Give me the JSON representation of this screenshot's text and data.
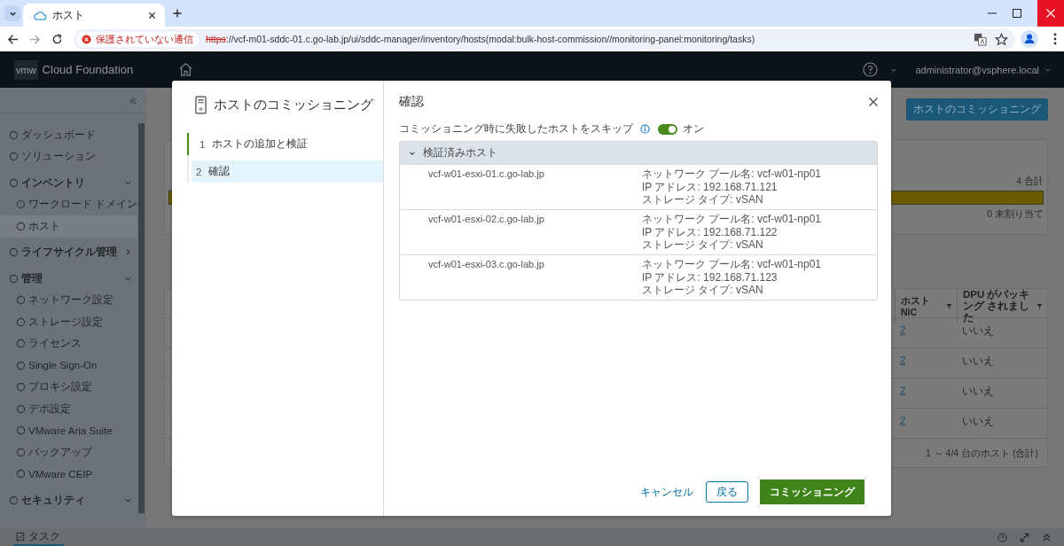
{
  "browser": {
    "tabs": [
      {
        "title": "ホスト",
        "selected": true
      }
    ],
    "security_label": "保護されていない通信",
    "url_scheme": "https",
    "url_rest": "://vcf-m01-sddc-01.c.go-lab.jp/ui/sddc-manager/inventory/hosts(modal:bulk-host-commission//monitoring-panel:monitoring/tasks)"
  },
  "app": {
    "logo": "vmw",
    "product": "Cloud Foundation",
    "user": "administrator@vsphere.local"
  },
  "sidebar": {
    "collapse": "«",
    "items": [
      {
        "kind": "link",
        "label": "ダッシュボード",
        "selected": false
      },
      {
        "kind": "link",
        "label": "ソリューション",
        "selected": false
      },
      {
        "kind": "group",
        "label": "インベントリ",
        "selected": false,
        "expanded": true,
        "children": [
          {
            "label": "ワークロード ドメイン",
            "selected": false
          },
          {
            "label": "ホスト",
            "selected": true
          }
        ]
      },
      {
        "kind": "group",
        "label": "ライフサイクル管理",
        "selected": false,
        "expanded": false
      },
      {
        "kind": "group",
        "label": "管理",
        "selected": false,
        "expanded": true,
        "children": [
          {
            "label": "ネットワーク設定",
            "selected": false
          },
          {
            "label": "ストレージ設定",
            "selected": false
          },
          {
            "label": "ライセンス",
            "selected": false
          },
          {
            "label": "Single Sign-On",
            "selected": false
          },
          {
            "label": "プロキシ設定",
            "selected": false
          },
          {
            "label": "デポ設定",
            "selected": false
          },
          {
            "label": "VMware Aria Suite",
            "selected": false
          },
          {
            "label": "バックアップ",
            "selected": false
          },
          {
            "label": "VMware CEIP",
            "selected": false
          }
        ]
      },
      {
        "kind": "group",
        "label": "セキュリティ",
        "selected": false,
        "expanded": true
      }
    ]
  },
  "page": {
    "action_button": "ホストのコミッショニング",
    "summary": {
      "total": "4 合計",
      "level": 1,
      "unassigned": "0 未割り当て"
    },
    "table": {
      "columns": [
        "ホスト NIC",
        "DPU がバッキング されました"
      ],
      "rows": [
        {
          "nic": "2",
          "dpu": "いいえ"
        },
        {
          "nic": "2",
          "dpu": "いいえ"
        },
        {
          "nic": "2",
          "dpu": "いいえ"
        },
        {
          "nic": "2",
          "dpu": "いいえ"
        }
      ],
      "footer": "1 ～ 4/4 台のホスト (合計)"
    }
  },
  "modal": {
    "title": "ホストのコミッショニング",
    "steps": [
      {
        "number": "1",
        "label": "ホストの追加と検証",
        "selected": false,
        "completed": true
      },
      {
        "number": "2",
        "label": "確認",
        "selected": true,
        "completed": false
      }
    ],
    "heading": "確認",
    "skip_option": {
      "label": "コミッショニング時に失敗したホストをスキップ",
      "on": true,
      "state_text": "オン"
    },
    "accordion": {
      "title": "検証済みホスト",
      "expanded": true,
      "hosts": [
        {
          "name": "vcf-w01-esxi-01.c.go-lab.jp",
          "details": [
            "ネットワーク プール名: vcf-w01-np01",
            "IP アドレス: 192.168.71.121",
            "ストレージ タイプ: vSAN"
          ]
        },
        {
          "name": "vcf-w01-esxi-02.c.go-lab.jp",
          "details": [
            "ネットワーク プール名: vcf-w01-np01",
            "IP アドレス: 192.168.71.122",
            "ストレージ タイプ: vSAN"
          ]
        },
        {
          "name": "vcf-w01-esxi-03.c.go-lab.jp",
          "details": [
            "ネットワーク プール名: vcf-w01-np01",
            "IP アドレス: 192.168.71.123",
            "ストレージ タイプ: vSAN"
          ]
        }
      ]
    },
    "buttons": [
      {
        "kind": "link",
        "label": "キャンセル",
        "highlighted": false
      },
      {
        "kind": "outline",
        "label": "戻る",
        "highlighted": false
      },
      {
        "kind": "primary",
        "label": "コミッショニング",
        "highlighted": true
      }
    ]
  },
  "taskbar": {
    "label": "タスク"
  }
}
